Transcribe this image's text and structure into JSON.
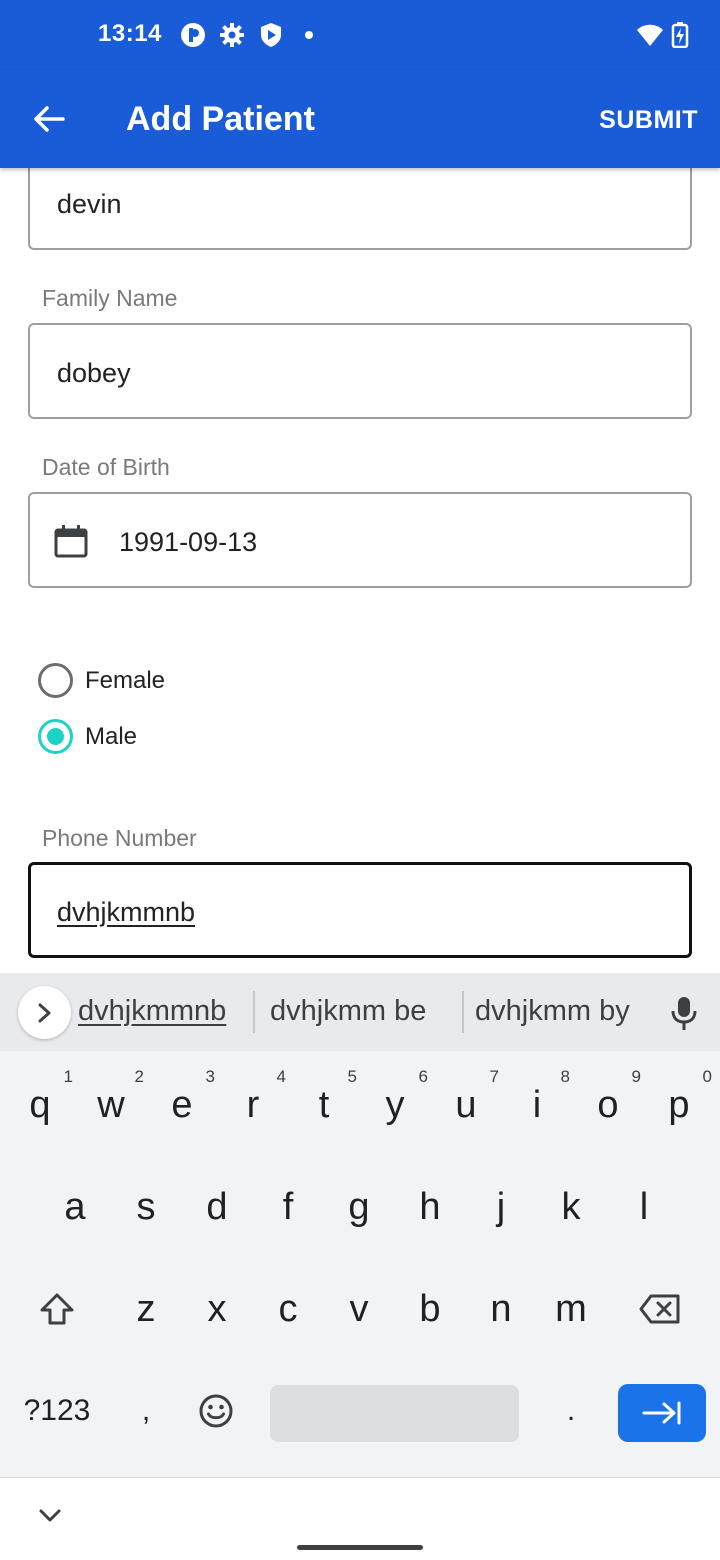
{
  "status_bar": {
    "time": "13:14",
    "left_icons": [
      "vpn-key-icon",
      "settings-icon",
      "shield-play-icon",
      "dot-icon"
    ],
    "right_icons": [
      "wifi-icon",
      "battery-charging-icon"
    ]
  },
  "app_bar": {
    "title": "Add Patient",
    "submit_label": "SUBMIT",
    "back_icon": "arrow-left-icon",
    "color": "#1a5cd8"
  },
  "form": {
    "given_name_value": "devin",
    "family_name_label": "Family Name",
    "family_name_value": "dobey",
    "dob_label": "Date of Birth",
    "dob_value": "1991-09-13",
    "gender_options": [
      {
        "label": "Female",
        "checked": false
      },
      {
        "label": "Male",
        "checked": true
      }
    ],
    "radio_accent": "#1bd3c6",
    "phone_label": "Phone Number",
    "phone_value": "dvhjkmmnb"
  },
  "keyboard": {
    "suggestions": [
      "dvhjkmmnb",
      "dvhjkmm be",
      "dvhjkmm by"
    ],
    "row1": [
      {
        "k": "q",
        "h": "1"
      },
      {
        "k": "w",
        "h": "2"
      },
      {
        "k": "e",
        "h": "3"
      },
      {
        "k": "r",
        "h": "4"
      },
      {
        "k": "t",
        "h": "5"
      },
      {
        "k": "y",
        "h": "6"
      },
      {
        "k": "u",
        "h": "7"
      },
      {
        "k": "i",
        "h": "8"
      },
      {
        "k": "o",
        "h": "9"
      },
      {
        "k": "p",
        "h": "0"
      }
    ],
    "row2": [
      "a",
      "s",
      "d",
      "f",
      "g",
      "h",
      "j",
      "k",
      "l"
    ],
    "row3": [
      "z",
      "x",
      "c",
      "v",
      "b",
      "n",
      "m"
    ],
    "symbols_label": "?123",
    "comma_label": ",",
    "period_label": ".",
    "enter_color": "#1a73e8"
  }
}
